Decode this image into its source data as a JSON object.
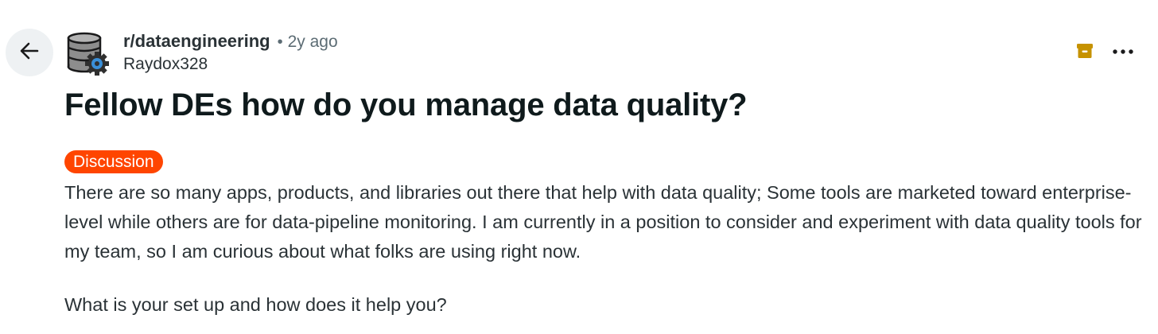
{
  "header": {
    "back_icon": "arrow-left-icon",
    "subreddit_icon": "database-gear-icon",
    "subreddit": "r/dataengineering",
    "separator": "•",
    "time_ago": "2y ago",
    "author": "Raydox328",
    "archive_icon": "archive-icon",
    "more_icon": "more-horizontal-icon"
  },
  "post": {
    "title": "Fellow DEs how do you manage data quality?",
    "flair": "Discussion",
    "body": [
      "There are so many apps, products, and libraries out there that help with data quality; Some tools are marketed toward enterprise-level while others are for data-pipeline monitoring. I am currently in a position to consider and experiment with data quality tools for my team, so I am curious about what folks are using right now.",
      "What is your set up and how does it help you?"
    ]
  },
  "colors": {
    "flair_bg": "#ff4500",
    "archive_icon": "#c69200",
    "back_bg": "#eef1f3",
    "text_primary": "#0f1a1c",
    "text_secondary": "#5c6c74"
  }
}
